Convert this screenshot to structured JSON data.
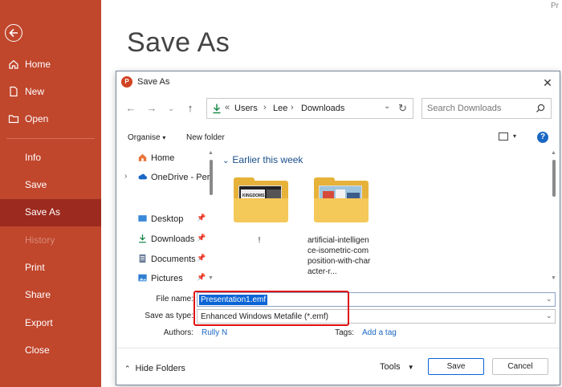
{
  "backstage": {
    "title": "Save As",
    "corner_text": "Pr",
    "nav": {
      "home": "Home",
      "new": "New",
      "open": "Open",
      "info": "Info",
      "save": "Save",
      "save_as": "Save As",
      "history": "History",
      "print": "Print",
      "share": "Share",
      "export": "Export",
      "close": "Close"
    },
    "colors": {
      "sidebar": "#c0462c",
      "selected": "#9c2a1e"
    }
  },
  "dialog": {
    "title": "Save As",
    "breadcrumb": {
      "overflow": "«",
      "items": [
        "Users",
        "Lee",
        "Downloads"
      ]
    },
    "search_placeholder": "Search Downloads",
    "toolbar": {
      "organise": "Organise",
      "new_folder": "New folder"
    },
    "tree": {
      "home": "Home",
      "onedrive": "OneDrive - Per",
      "desktop": "Desktop",
      "downloads": "Downloads",
      "documents": "Documents",
      "pictures": "Pictures"
    },
    "group_header": "Earlier this week",
    "files": [
      {
        "name": "!",
        "thumb_text": "KINGDOMS"
      },
      {
        "name": "artificial-intelligence-isometric-composition-with-character-r..."
      }
    ],
    "form": {
      "file_name_label": "File name:",
      "file_name_value": "Presentation1.emf",
      "save_type_label": "Save as type:",
      "save_type_value": "Enhanced Windows Metafile (*.emf)",
      "authors_label": "Authors:",
      "authors_value": "Rully N",
      "tags_label": "Tags:",
      "tags_value": "Add a tag"
    },
    "footer": {
      "hide_folders": "Hide Folders",
      "tools": "Tools",
      "save": "Save",
      "cancel": "Cancel"
    },
    "highlight_color": "#e01010"
  }
}
